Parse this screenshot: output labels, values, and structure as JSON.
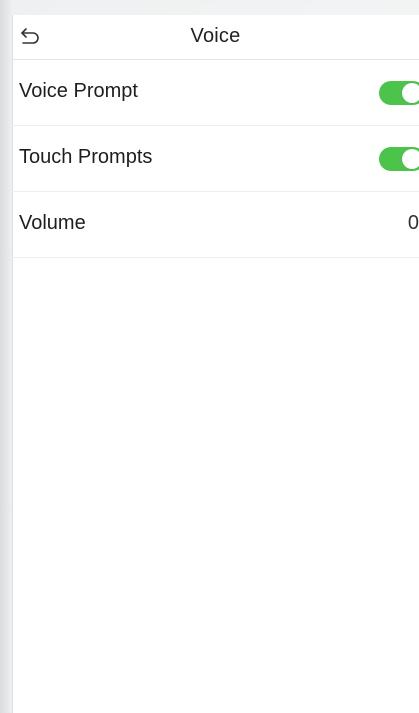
{
  "header": {
    "title": "Voice"
  },
  "settings": [
    {
      "label": "Voice Prompt",
      "type": "toggle",
      "on": true
    },
    {
      "label": "Touch Prompts",
      "type": "toggle",
      "on": true
    },
    {
      "label": "Volume",
      "type": "value",
      "value": "0"
    }
  ],
  "icons": {
    "back": "back-arrow-icon"
  },
  "colors": {
    "toggle_on": "#4cc44c",
    "background": "#ffffff"
  }
}
